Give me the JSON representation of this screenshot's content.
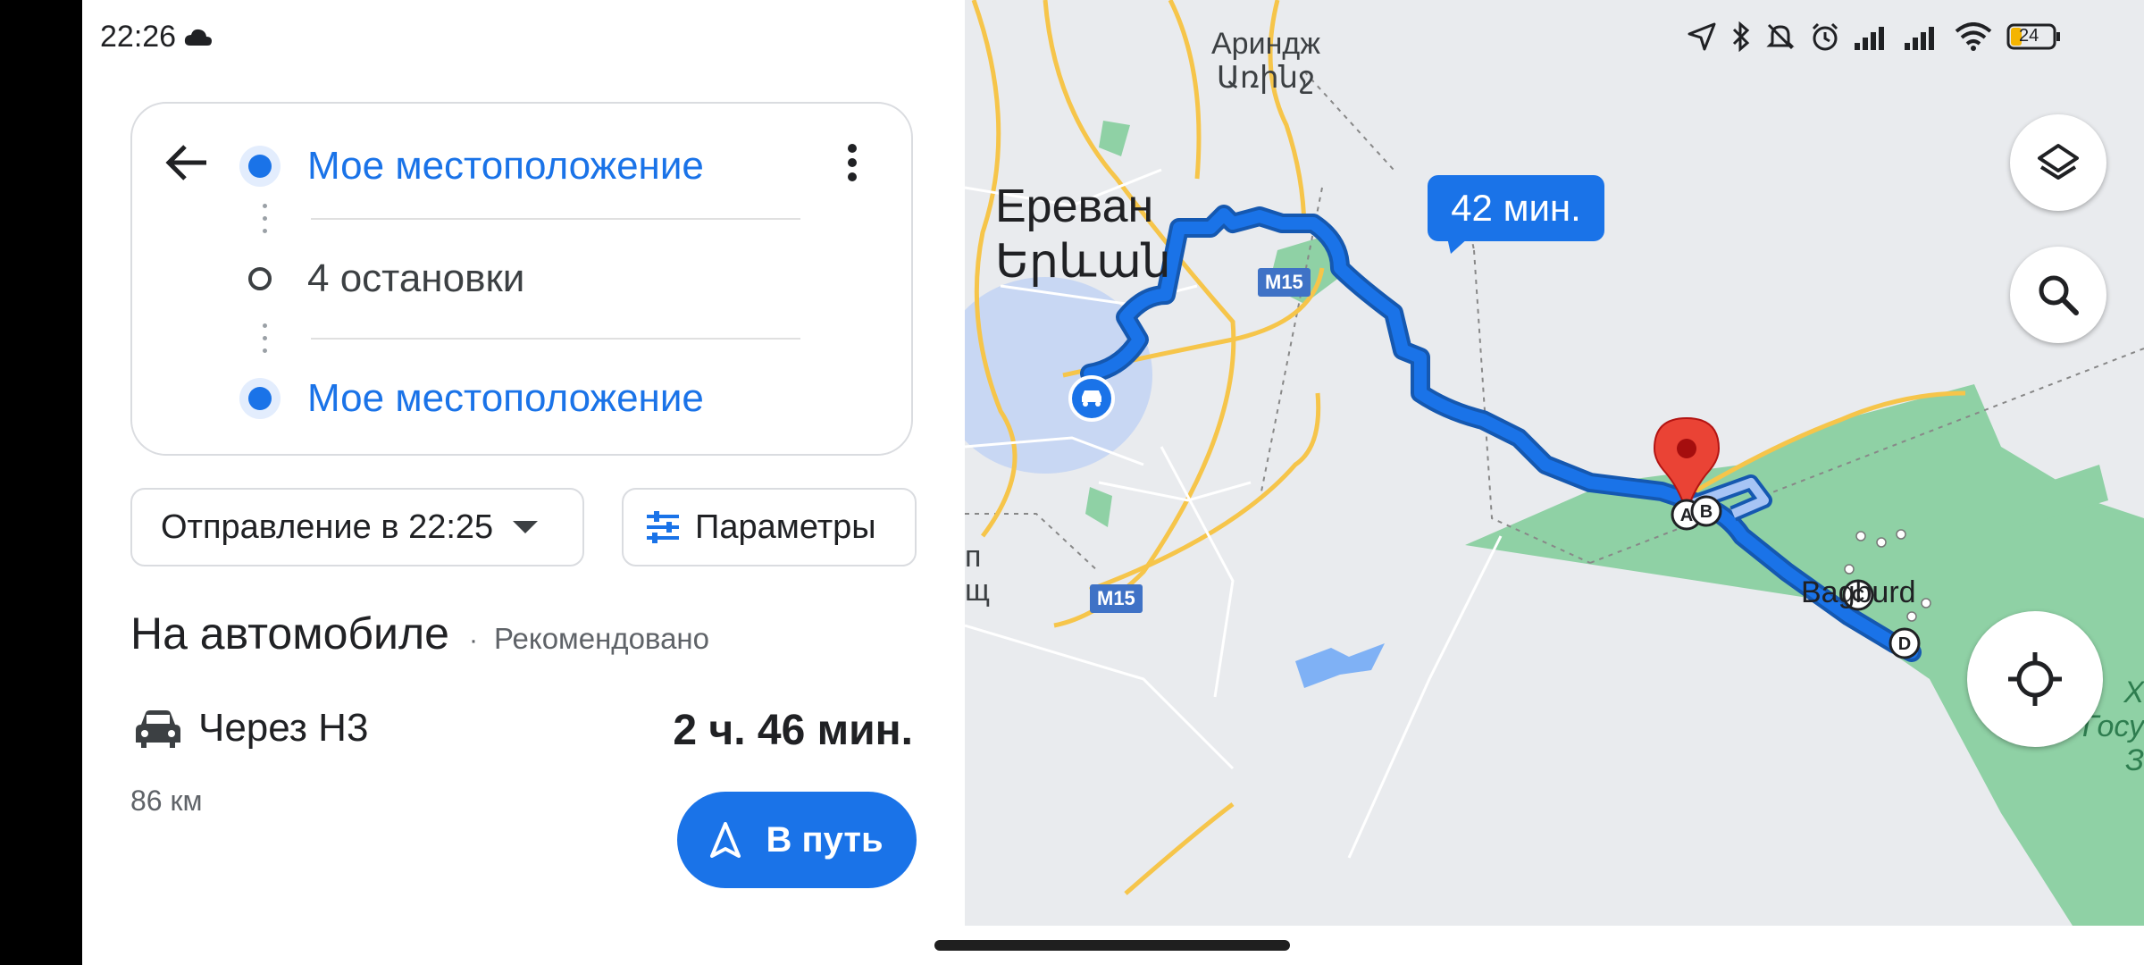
{
  "status": {
    "time": "22:26",
    "weather_icon": "cloud-icon",
    "battery": "24"
  },
  "route_card": {
    "origin": "Мое местоположение",
    "stops": "4 остановки",
    "destination": "Мое местоположение"
  },
  "options": {
    "departure": "Отправление в 22:25",
    "params": "Параметры"
  },
  "mode": {
    "title": "На автомобиле",
    "separator": "·",
    "note": "Рекомендовано"
  },
  "route": {
    "via": "Через Н3",
    "duration": "2 ч. 46 мин.",
    "distance": "86 км",
    "go_label": "В путь"
  },
  "map": {
    "eta": "42 мин.",
    "city_ru": "Ереван",
    "city_hy": "Երևան",
    "town_ru": "Ариндж",
    "town_hy": "Առինջ",
    "village": "Bagburd",
    "road_1": "M15",
    "road_2": "M15",
    "edge_1": "п",
    "edge_2": "щ",
    "edge_right": "Х Госу З",
    "markers": [
      "A",
      "B",
      "C",
      "D"
    ],
    "colors": {
      "route": "#1a73e8",
      "route_outline": "#1558b0",
      "park": "#8fd1a5",
      "road": "#f6c54a",
      "water": "#7fb1f5",
      "pin": "#ea4335"
    }
  }
}
